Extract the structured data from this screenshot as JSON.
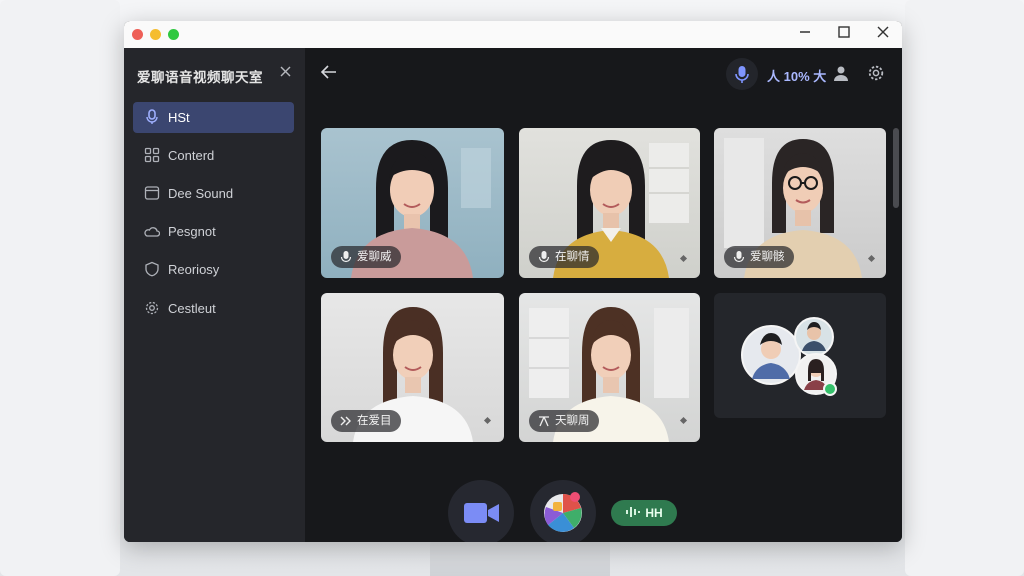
{
  "app": {
    "title": "爱聊语音视频聊天室"
  },
  "sidebar": {
    "items": [
      {
        "label": "HSt",
        "icon": "mic-icon",
        "active": true
      },
      {
        "label": "Conterd",
        "icon": "grid-icon",
        "active": false
      },
      {
        "label": "Dee Sound",
        "icon": "window-icon",
        "active": false
      },
      {
        "label": "Pesgnot",
        "icon": "cloud-icon",
        "active": false
      },
      {
        "label": "Reoriosy",
        "icon": "shield-icon",
        "active": false
      },
      {
        "label": "Cestleut",
        "icon": "gear-icon",
        "active": false
      }
    ]
  },
  "header": {
    "level": "人 10% 大"
  },
  "participants": [
    {
      "name": "爱聊威",
      "status_icon": "mic-icon"
    },
    {
      "name": "在聊情",
      "status_icon": "mic-icon"
    },
    {
      "name": "爱聊骸",
      "status_icon": "mic-icon"
    },
    {
      "name": "在爱目",
      "status_icon": "forward-icon"
    },
    {
      "name": "天聊周",
      "status_icon": "translate-icon"
    }
  ],
  "controls": {
    "audio_label": "HH"
  },
  "colors": {
    "accent": "#3b4670",
    "accent_text": "#aab8ff",
    "online": "#35c06b",
    "audio_pill": "#2f7a4f"
  }
}
